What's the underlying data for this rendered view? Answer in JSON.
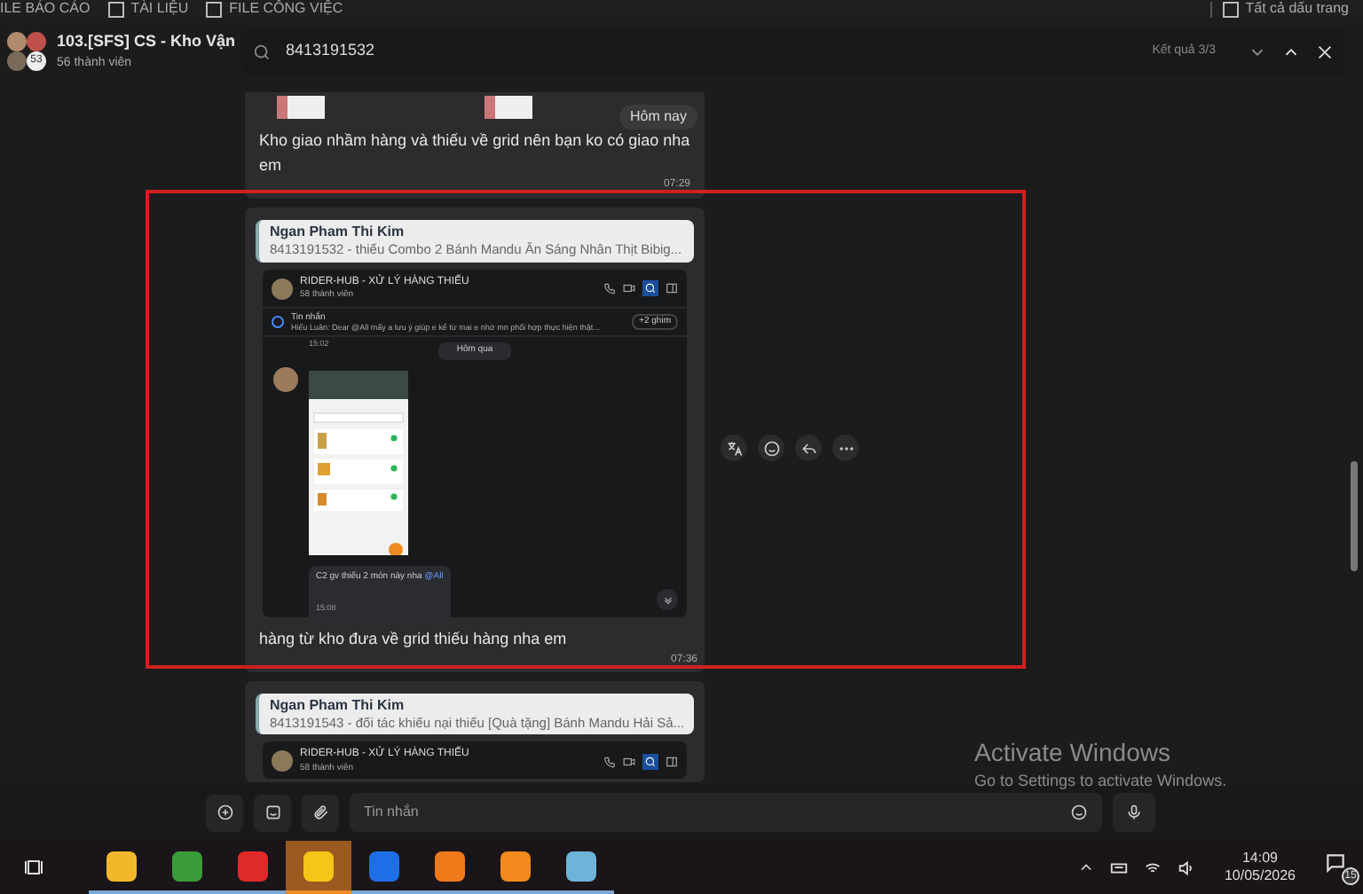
{
  "top_strip": {
    "items": [
      {
        "label": "ILE BÁO CÁO"
      },
      {
        "label": "TÀI LIỆU",
        "checked": false
      },
      {
        "label": "FILE CÔNG VIỆC",
        "checked": false
      }
    ],
    "right": {
      "label": "Tất cả dấu trang",
      "checked": false
    }
  },
  "header": {
    "group_name": "103.[SFS] CS - Kho Vận",
    "members": "56 thành viên",
    "avatar_badge": "53"
  },
  "search": {
    "value": "8413191532",
    "results": "Kết quả 3/3"
  },
  "messages": [
    {
      "kind": "images",
      "date_badge": "Hôm nay",
      "text": "Kho giao nhầm hàng và thiếu về grid nên bạn ko có giao nha em",
      "time": "07:29"
    },
    {
      "kind": "quote",
      "highlighted": true,
      "quote": {
        "author": "Ngan Pham Thi Kim",
        "text": "8413191532 - thiếu Combo 2 Bánh Mandu Ăn Sáng Nhân Thịt Bibig..."
      },
      "embed": {
        "title": "RIDER-HUB - XỬ LÝ HÀNG THIẾU",
        "members": "58 thành viên",
        "pinned_label": "Tin nhắn",
        "pinned_text": "Hiếu Luân: Dear @All mấy a lưu ý giúp e  kể từ mai e nhờ mn phối hợp thực hiện thật...",
        "pinned_more": "+2 ghim",
        "time_top": "15:02",
        "date": "Hôm qua",
        "reply_text": "C2 gv thiếu 2 món này nha",
        "reply_mention": "@All",
        "reply_time": "15:08"
      },
      "text": "hàng từ kho đưa về grid thiếu hàng nha em",
      "time": "07:36"
    },
    {
      "kind": "quote",
      "quote": {
        "author": "Ngan Pham Thi Kim",
        "text": "8413191543 - đối tác khiếu nại thiếu [Quà tặng] Bánh Mandu Hải Sả..."
      },
      "embed": {
        "title": "RIDER-HUB - XỬ LÝ HÀNG THIẾU",
        "members": "58 thành viên"
      }
    }
  ],
  "composer": {
    "placeholder": "Tin nhắn"
  },
  "activation": {
    "title": "Activate Windows",
    "text": "Go to Settings to activate Windows."
  },
  "taskbar": {
    "apps": [
      {
        "kind": "folder",
        "selected": false
      },
      {
        "kind": "green",
        "selected": false
      },
      {
        "kind": "wps",
        "selected": false
      },
      {
        "kind": "sticky",
        "selected": true
      },
      {
        "kind": "zalo",
        "selected": false
      },
      {
        "kind": "vpn",
        "selected": false
      },
      {
        "kind": "hex",
        "selected": false
      },
      {
        "kind": "book",
        "selected": false
      }
    ],
    "time": "14:09",
    "date": "10/05/2026",
    "notifications": "15"
  }
}
